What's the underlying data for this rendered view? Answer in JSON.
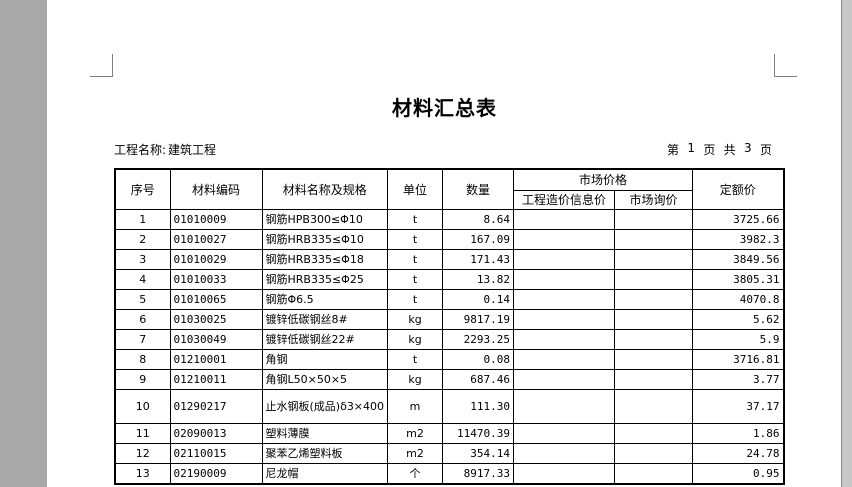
{
  "document": {
    "title": "材料汇总表",
    "project_label": "工程名称:",
    "project_name": "建筑工程",
    "page_info": [
      "第",
      "1",
      "页",
      "共",
      "3",
      "页"
    ]
  },
  "table": {
    "headers": {
      "index": "序号",
      "code": "材料编码",
      "name": "材料名称及规格",
      "unit": "单位",
      "quantity": "数量",
      "market_price": "市场价格",
      "info_price": "工程造价信息价",
      "inquiry_price": "市场询价",
      "fixed_price": "定额价"
    },
    "rows": [
      {
        "index": "1",
        "code": "01010009",
        "name": "钢筋HPB300≤Φ10",
        "unit": "t",
        "quantity": "8.64",
        "info_price": "",
        "inquiry_price": "",
        "fixed_price": "3725.66"
      },
      {
        "index": "2",
        "code": "01010027",
        "name": "钢筋HRB335≤Φ10",
        "unit": "t",
        "quantity": "167.09",
        "info_price": "",
        "inquiry_price": "",
        "fixed_price": "3982.3"
      },
      {
        "index": "3",
        "code": "01010029",
        "name": "钢筋HRB335≤Φ18",
        "unit": "t",
        "quantity": "171.43",
        "info_price": "",
        "inquiry_price": "",
        "fixed_price": "3849.56"
      },
      {
        "index": "4",
        "code": "01010033",
        "name": "钢筋HRB335≤Φ25",
        "unit": "t",
        "quantity": "13.82",
        "info_price": "",
        "inquiry_price": "",
        "fixed_price": "3805.31"
      },
      {
        "index": "5",
        "code": "01010065",
        "name": "钢筋Φ6.5",
        "unit": "t",
        "quantity": "0.14",
        "info_price": "",
        "inquiry_price": "",
        "fixed_price": "4070.8"
      },
      {
        "index": "6",
        "code": "01030025",
        "name": "镀锌低碳钢丝8#",
        "unit": "kg",
        "quantity": "9817.19",
        "info_price": "",
        "inquiry_price": "",
        "fixed_price": "5.62"
      },
      {
        "index": "7",
        "code": "01030049",
        "name": "镀锌低碳钢丝22#",
        "unit": "kg",
        "quantity": "2293.25",
        "info_price": "",
        "inquiry_price": "",
        "fixed_price": "5.9"
      },
      {
        "index": "8",
        "code": "01210001",
        "name": "角钢",
        "unit": "t",
        "quantity": "0.08",
        "info_price": "",
        "inquiry_price": "",
        "fixed_price": "3716.81"
      },
      {
        "index": "9",
        "code": "01210011",
        "name": "角钢L50×50×5",
        "unit": "kg",
        "quantity": "687.46",
        "info_price": "",
        "inquiry_price": "",
        "fixed_price": "3.77"
      },
      {
        "index": "10",
        "code": "01290217",
        "name": "止水钢板(成品)δ3×400",
        "unit": "m",
        "quantity": "111.30",
        "info_price": "",
        "inquiry_price": "",
        "fixed_price": "37.17"
      },
      {
        "index": "11",
        "code": "02090013",
        "name": "塑料薄膜",
        "unit": "m2",
        "quantity": "11470.39",
        "info_price": "",
        "inquiry_price": "",
        "fixed_price": "1.86"
      },
      {
        "index": "12",
        "code": "02110015",
        "name": "聚苯乙烯塑料板",
        "unit": "m2",
        "quantity": "354.14",
        "info_price": "",
        "inquiry_price": "",
        "fixed_price": "24.78"
      },
      {
        "index": "13",
        "code": "02190009",
        "name": "尼龙帽",
        "unit": "个",
        "quantity": "8917.33",
        "info_price": "",
        "inquiry_price": "",
        "fixed_price": "0.95"
      }
    ]
  }
}
